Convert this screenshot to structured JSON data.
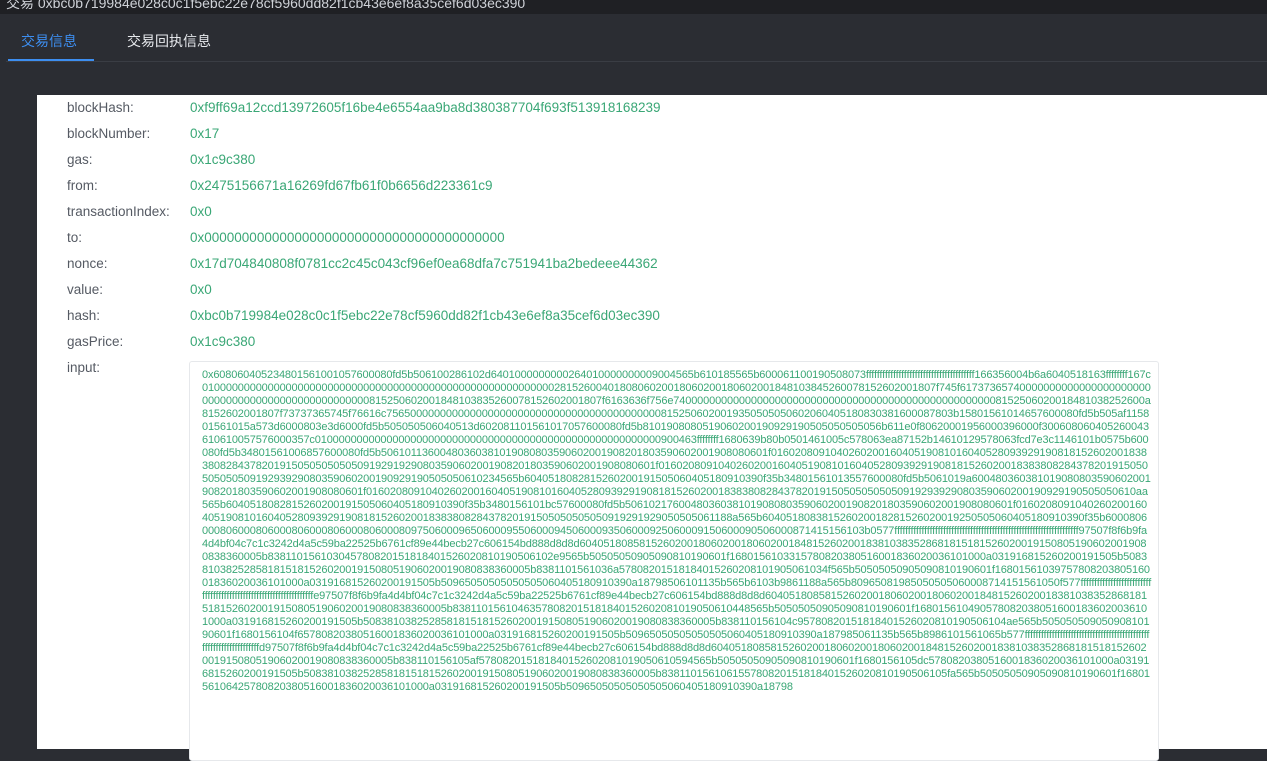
{
  "window": {
    "title": "交易 0xbc0b719984e028c0c1f5ebc22e78cf5960dd82f1cb43e6ef8a35cef6d03ec390"
  },
  "tabs": [
    {
      "label": "交易信息",
      "active": true
    },
    {
      "label": "交易回执信息",
      "active": false
    }
  ],
  "fields": [
    {
      "key": "blockHash:",
      "value": "0xf9ff69a12ccd13972605f16be4e6554aa9ba8d380387704f693f513918168239"
    },
    {
      "key": "blockNumber:",
      "value": "0x17"
    },
    {
      "key": "gas:",
      "value": "0x1c9c380"
    },
    {
      "key": "from:",
      "value": "0x2475156671a16269fd67fb61f0b6656d223361c9"
    },
    {
      "key": "transactionIndex:",
      "value": "0x0"
    },
    {
      "key": "to:",
      "value": "0x0000000000000000000000000000000000000000"
    },
    {
      "key": "nonce:",
      "value": "0x17d704840808f0781cc2c45c043cf96ef0ea68dfa7c751941ba2bedeee44362"
    },
    {
      "key": "value:",
      "value": "0x0"
    },
    {
      "key": "hash:",
      "value": "0xbc0b719984e028c0c1f5ebc22e78cf5960dd82f1cb43e6ef8a35cef6d03ec390"
    },
    {
      "key": "gasPrice:",
      "value": "0x1c9c380"
    }
  ],
  "input": {
    "key": "input:",
    "value": "0x608060405234801561001057600080fd5b506100286102d6401000000000264010000000009004565b610185565b600061100190508073ffffffffffffffffffffffffffffffffffffffff166356004b6a6040518163ffffffff167c01000000000000000000000000000000000000000000000000000000000281526004018080602001806020018060200184810384526007815260200180​7f745f6173736574000000000000000000000000000000000000000000000000008152506020018481038352600781526020018​07f6163636f756e7400000000000000000000000000000000000000000000000000008152506020018481038252600a815260200180​7f73737365745f76616c7565000000000000000000000000000000000000000000815250602001935050505060206040518083038160008​7803b158015610146576000​80fd5b505af11580156101​5a573d6000803e3d6000fd5b505050506040513d602081101561017057600080fd5b8101908080519060200190929190505050505056b611e0f80620001956000396000f300608060405260043610610057576000357c01000000000000000000000000000000000000000000000000000000009004​63ffffffff1680639b80b0501461005c578063ea87152b14610129578063fcd7e3c11461​01b0575b600080fd5b348015610068576000​80fd5b5061011360048036038101908080359060200190820180359060200190808060​1f01602080910402602001604051908101604052809392919081815260200183838082843782019150505050505091929192908035906020019082018035906020019080806​01f016020809104026020016040519081016040528093929190818152602001838380828437820191505050505050919293929080359060200190929190505050610234565b6040518082815260200191505060405180910390f35b34801561013557600080fd5b5061019a60048036038101908080359060200190820180359060200190808060​1f016020809104026020016040519081016040528093929190818152602001838380828437820191505050505050919293929080359060200190929190505050610​aa565b60405180828152602001915050604051809103​90f35b34801561​01bc57600080fd5b506102176004803603810190808035906020019082018035906020019080806​01f0160208091040260200160405190810160405280939291908181526020018383808284378201915050505050509192919290505050611​88a565b60405180838152602001828152602001925050506040518091039​0f35b60008060008060008060008060008060008060​00809750600096506000955060009450600093506​0009250600091506000905060008714151561​03b057​7ffffffffffffffffffffffffffffffffffffffffffffffffffffffffffffffffffff97507f8f6b9fa4d4bf04c7c1c3242d4a5c59ba22525b6761cf89e44becb27c606154bd888d8d8d60405180858152602001806020018060200184815260200183810383528681815181526020019150805190602001908083836000​5b838110156103045780820151818401526020810190506102e9565b50505050905090810190601f1680156103315780820380516001836020036101000a031916815260200191505b508381038252858181518152602001915080519060200190808383600​05b838110156103​6a578082015181840152602081019050610​34f565b505050509050908101906​01f16801561​0397578082038051600183602003​6101000a031916815260200191505b5096505050505050506040518091039​0a187985061​01135b565b6103b98​61188a565b809650819850505050​60008714151561050f577fffffffffffffffffffffffffffffffffffffffffffffffffffffffffffffffffff​e97507f8f6b9fa4d4bf04c7c1c3242d4a5c59ba22525b6761cf89e44becb27c606154bd888d8d8d60405180858152602001806020018060200184815260200183810383528681815181526020019150805190602001908083836000​5b838110156104635780820151818401526020810190506104485​65b50505050905090810190601f16801561​0490578082038051600183602003​6101000a031916815260200191505b508381038252858181518152602001915080519060200190808383600​05b838110156104c957808201518184015260208101905061​04ae565b505050509050908101906​01f16801561​04f657808203805160018360200361​01000a031916815260200191505b5096505050505050506040518091039​0a187985061​135b565b89861015​61065b577fffffffffffffffffffffffffffffffffffffffffffffffffffffffffffffffffffd97507f8f6b9fa4d4bf04c7c1c3242d4a5c59ba22525b6761cf89e44becb27c606154bd888d8d8d60405180858152602001806020018060200184815260200183810383528681815181526020019150805190602001908083836000​5b838110156105af578082015181840152602081019050610594565b50505050905090810190601f1680156105dc5780820380516001836020036101000a031916815260200191505b508381038252858181518152602001915080519060200190808383600​05b838110156106155780820151818401526020810190506105fa565b50505050905090810190601f16801561​06425780820380516001836020036101000a031916815260200191505b50965050505050505060405180910390a18798"
  }
}
